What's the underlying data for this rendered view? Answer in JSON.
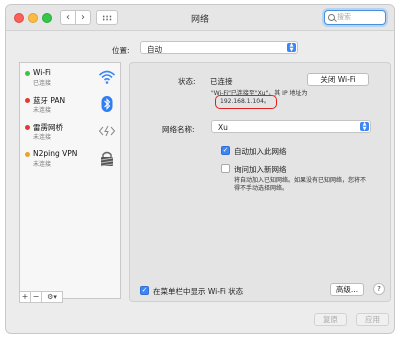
{
  "window": {
    "title": "网络"
  },
  "search": {
    "placeholder": "搜索"
  },
  "location": {
    "label": "位置:",
    "value": "自动"
  },
  "sidebar": {
    "items": [
      {
        "name": "Wi-Fi",
        "status": "已连接",
        "dot_color": "#3ec445",
        "icon": "wifi-icon"
      },
      {
        "name": "蓝牙 PAN",
        "status": "未连接",
        "dot_color": "#e03b30",
        "icon": "bluetooth-icon"
      },
      {
        "name": "雷雳网桥",
        "status": "未连接",
        "dot_color": "#e03b30",
        "icon": "thunderbolt-bridge-icon"
      },
      {
        "name": "N2ping VPN",
        "status": "未连接",
        "dot_color": "#e8a42c",
        "icon": "vpn-lock-icon"
      }
    ],
    "add": "+",
    "remove": "−",
    "gear": "⚙▾"
  },
  "detail": {
    "status_label": "状态:",
    "status_value": "已连接",
    "turn_off_button": "关闭 Wi-Fi",
    "status_desc": "\"Wi-Fi\"已连接至\"Xu\"，其 IP 地址为",
    "ip_address": "192.168.1.104。",
    "network_name_label": "网络名称:",
    "network_name_value": "Xu",
    "auto_join_label": "自动加入此网络",
    "ask_join_label": "询问加入新网络",
    "ask_join_desc_1": "将自动加入已知网络。如果没有已知网络，您将不",
    "ask_join_desc_2": "得不手动选择网络。",
    "show_status_label": "在菜单栏中显示 Wi-Fi 状态",
    "advanced_button": "高级...",
    "help_button": "?"
  },
  "footer": {
    "revert_button": "复原",
    "apply_button": "应用"
  },
  "colors": {
    "accent": "#3d86f5",
    "highlight": "#e02020"
  }
}
